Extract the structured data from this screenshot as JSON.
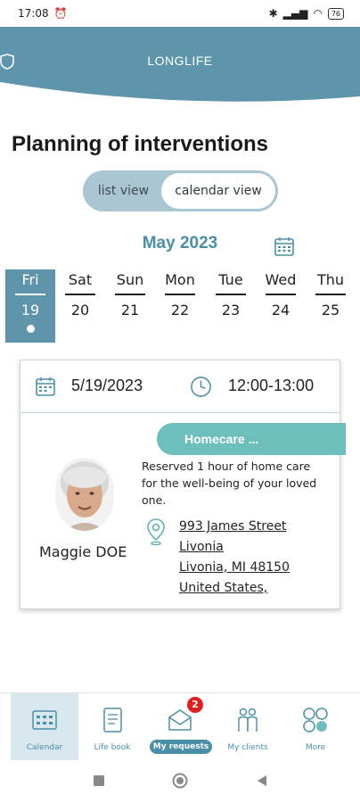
{
  "status_bar": {
    "time": "17:08",
    "battery": "76"
  },
  "header": {
    "logo_text": "LONGLIFE"
  },
  "page_title": "Planning of interventions",
  "view_toggle": {
    "list_label": "list view",
    "calendar_label": "calendar view",
    "selected": "calendar view"
  },
  "calendar": {
    "month": "May 2023",
    "days": [
      {
        "name": "Fri",
        "num": "19",
        "active": true
      },
      {
        "name": "Sat",
        "num": "20"
      },
      {
        "name": "Sun",
        "num": "21"
      },
      {
        "name": "Mon",
        "num": "22"
      },
      {
        "name": "Tue",
        "num": "23"
      },
      {
        "name": "Wed",
        "num": "24"
      },
      {
        "name": "Thu",
        "num": "25"
      }
    ]
  },
  "appointment": {
    "date": "5/19/2023",
    "time": "12:00-13:00",
    "service": "Homecare ...",
    "description": "Reserved 1 hour of home care for the well-being of your loved one.",
    "client_name": "Maggie DOE",
    "address": [
      "993 James Street",
      "Livonia",
      "Livonia, MI 48150",
      "United States,"
    ]
  },
  "bottom_nav": {
    "items": [
      {
        "label": "Calendar",
        "icon": "calendar-grid-icon"
      },
      {
        "label": "Life book",
        "icon": "notebook-icon"
      },
      {
        "label": "My requests",
        "icon": "envelope-icon",
        "badge": "2"
      },
      {
        "label": "My clients",
        "icon": "people-icon"
      },
      {
        "label": "More",
        "icon": "more-circles-icon"
      }
    ]
  },
  "colors": {
    "primary": "#5f95ab",
    "accent": "#6cbfba",
    "badge": "#e02020"
  }
}
